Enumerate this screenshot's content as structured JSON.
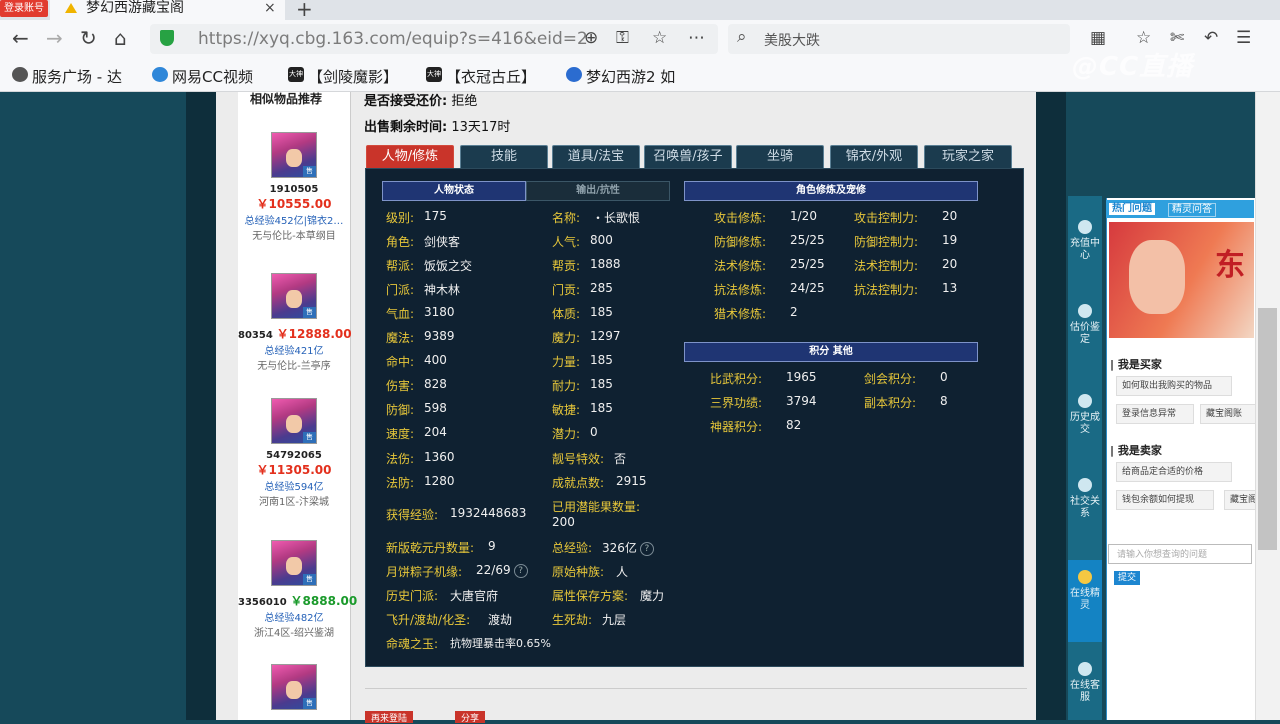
{
  "browser": {
    "badge": "登录账号",
    "tab_title": "梦幻西游藏宝阁",
    "tab_close": "×",
    "new_tab": "+",
    "url": "https://xyq.cbg.163.com/equip?s=416&eid=2",
    "search_text": "美股大跌",
    "bookmarks": [
      "服务广场 - 达",
      "网易CC视频",
      "【剑陵魔影】",
      "【衣冠古丘】",
      "梦幻西游2 如"
    ],
    "bookmark_icon_text": "大神",
    "watermark": "@CC直播"
  },
  "sidebar": {
    "title": "相似物品推荐",
    "items": [
      {
        "id": "1910505",
        "price": "￥10555.00",
        "exp": "总经验452亿|锦衣2…",
        "server": "无与伦比-本草纲目"
      },
      {
        "id": "80354",
        "price": "￥12888.00",
        "exp": "总经验421亿",
        "server": "无与伦比-兰亭序"
      },
      {
        "id": "54792065",
        "price": "￥11305.00",
        "exp": "总经验594亿",
        "server": "河南1区-汴梁城"
      },
      {
        "id": "3356010",
        "price": "￥8888.00",
        "exp": "总经验482亿",
        "server": "浙江4区-绍兴鉴湖"
      }
    ],
    "tag": "售"
  },
  "info": {
    "bargain_label": "是否接受还价:",
    "bargain_value": "拒绝",
    "remain_label": "出售剩余时间:",
    "remain_value": "13天17时"
  },
  "tabs": [
    "人物/修炼",
    "技能",
    "道具/法宝",
    "召唤兽/孩子",
    "坐骑",
    "锦衣/外观",
    "玩家之家"
  ],
  "headers": {
    "char_status": "人物状态",
    "output": "输出/抗性",
    "cultivation": "角色修炼及宠修",
    "points": "积分 其他"
  },
  "stats_left": [
    {
      "label": "级别:",
      "value": "175"
    },
    {
      "label": "角色:",
      "value": "剑侠客"
    },
    {
      "label": "帮派:",
      "value": "饭饭之交"
    },
    {
      "label": "门派:",
      "value": "神木林"
    },
    {
      "label": "气血:",
      "value": "3180"
    },
    {
      "label": "魔法:",
      "value": "9389"
    },
    {
      "label": "命中:",
      "value": "400"
    },
    {
      "label": "伤害:",
      "value": "828"
    },
    {
      "label": "防御:",
      "value": "598"
    },
    {
      "label": "速度:",
      "value": "204"
    },
    {
      "label": "法伤:",
      "value": "1360"
    },
    {
      "label": "法防:",
      "value": "1280"
    }
  ],
  "stats_mid": [
    {
      "label": "名称:",
      "value": "・长歌恨"
    },
    {
      "label": "人气:",
      "value": "800"
    },
    {
      "label": "帮贡:",
      "value": "1888"
    },
    {
      "label": "门贡:",
      "value": "285"
    },
    {
      "label": "体质:",
      "value": "185"
    },
    {
      "label": "魔力:",
      "value": "1297"
    },
    {
      "label": "力量:",
      "value": "185"
    },
    {
      "label": "耐力:",
      "value": "185"
    },
    {
      "label": "敏捷:",
      "value": "185"
    },
    {
      "label": "潜力:",
      "value": "0"
    },
    {
      "label": "靓号特效:",
      "value": "否"
    },
    {
      "label": "成就点数:",
      "value": "2915"
    }
  ],
  "extra": {
    "exp_label": "获得经验:",
    "exp_value": "1932448683",
    "fruit_label": "已用潜能果数量:",
    "fruit_value": "200",
    "qy_label": "新版乾元丹数量:",
    "qy_value": "9",
    "total_label": "总经验:",
    "total_value": "326亿",
    "moon_label": "月饼粽子机缘:",
    "moon_value": "22/69",
    "race_label": "原始种族:",
    "race_value": "人",
    "hist_label": "历史门派:",
    "hist_value": "大唐官府",
    "attr_label": "属性保存方案:",
    "attr_value": "魔力",
    "fly_label": "飞升/渡劫/化圣:",
    "fly_value": "渡劫",
    "life_label": "生死劫:",
    "life_value": "九层",
    "soul_label": "命魂之玉:",
    "soul_value": "抗物理暴击率0.65%",
    "q": "?"
  },
  "cultivation": [
    {
      "label": "攻击修炼:",
      "value": "1/20",
      "label2": "攻击控制力:",
      "value2": "20"
    },
    {
      "label": "防御修炼:",
      "value": "25/25",
      "label2": "防御控制力:",
      "value2": "19"
    },
    {
      "label": "法术修炼:",
      "value": "25/25",
      "label2": "法术控制力:",
      "value2": "20"
    },
    {
      "label": "抗法修炼:",
      "value": "24/25",
      "label2": "抗法控制力:",
      "value2": "13"
    },
    {
      "label": "猎术修炼:",
      "value": "2",
      "label2": "",
      "value2": ""
    }
  ],
  "points": [
    {
      "label": "比武积分:",
      "value": "1965",
      "label2": "剑会积分:",
      "value2": "0"
    },
    {
      "label": "三界功绩:",
      "value": "3794",
      "label2": "副本积分:",
      "value2": "8"
    },
    {
      "label": "神器积分:",
      "value": "82",
      "label2": "",
      "value2": ""
    }
  ],
  "bottom_buttons": [
    "再来登陆",
    "分享"
  ],
  "float": {
    "items": [
      "充值中心",
      "估价鉴定",
      "历史成交",
      "社交关系",
      "在线精灵",
      "在线客服"
    ],
    "help_tabs": [
      "热门问题",
      "精灵问答"
    ],
    "banner_char": "东",
    "sec_buyer": "| 我是买家",
    "buyer_q": [
      "如何取出我购买的物品",
      "登录信息异常",
      "藏宝阁账"
    ],
    "sec_seller": "| 我是卖家",
    "seller_q": [
      "给商品定合适的价格",
      "钱包余额如何提现",
      "藏宝阁"
    ],
    "ask_placeholder": "请输入你想查询的问题",
    "ask_button": "提交"
  }
}
